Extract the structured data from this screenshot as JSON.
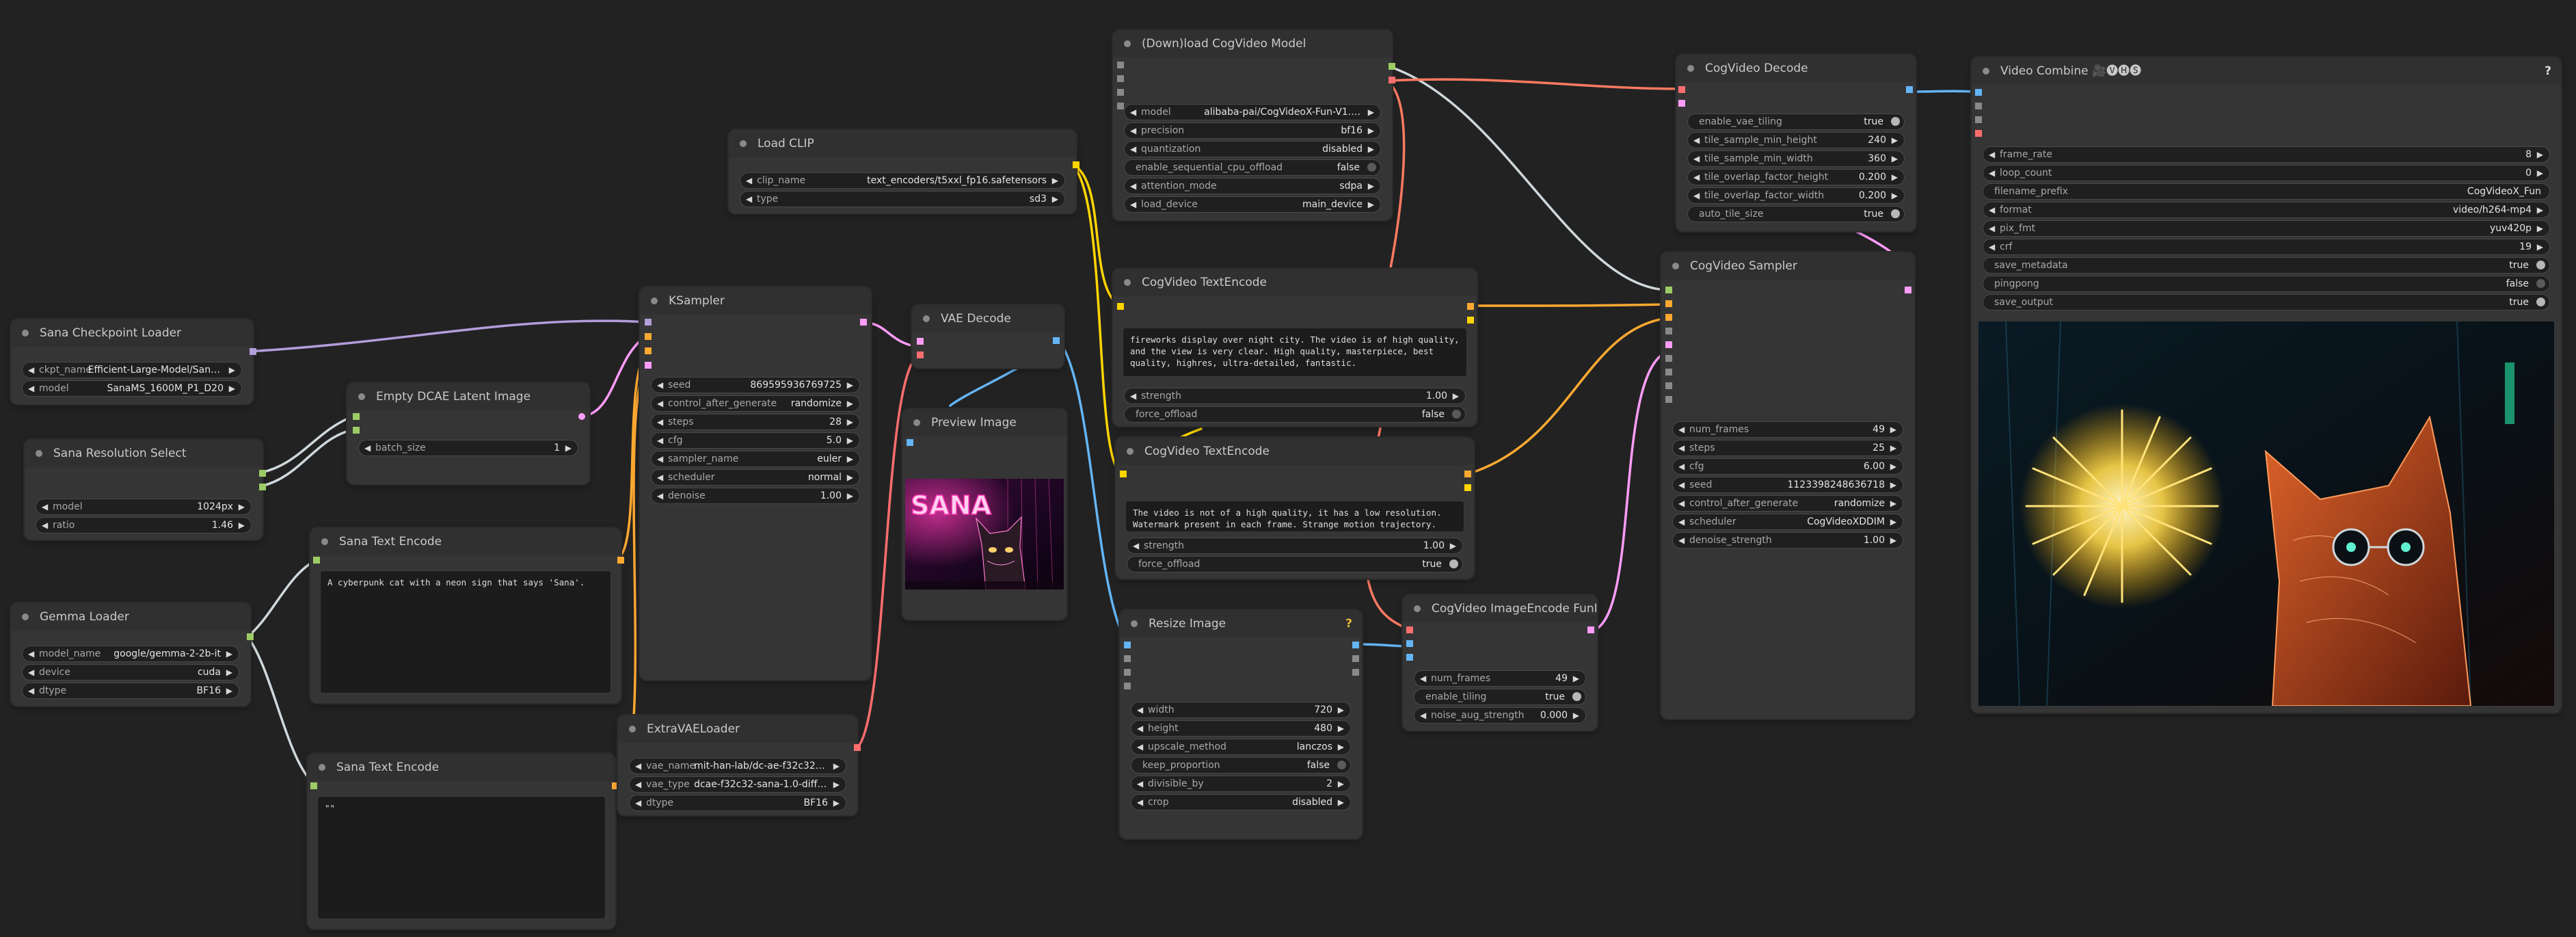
{
  "nodes": {
    "sana_ckpt": {
      "title": "Sana Checkpoint Loader",
      "ckpt_name": {
        "label": "ckpt_name",
        "value": "Efficient-Large-Model/Sana_..."
      },
      "model": {
        "label": "model",
        "value": "SanaMS_1600M_P1_D20"
      }
    },
    "sana_res": {
      "title": "Sana Resolution Select",
      "model": {
        "label": "model",
        "value": "1024px"
      },
      "ratio": {
        "label": "ratio",
        "value": "1.46"
      }
    },
    "gemma": {
      "title": "Gemma Loader",
      "model_name": {
        "label": "model_name",
        "value": "google/gemma-2-2b-it"
      },
      "device": {
        "label": "device",
        "value": "cuda"
      },
      "dtype": {
        "label": "dtype",
        "value": "BF16"
      }
    },
    "dcae": {
      "title": "Empty DCAE Latent Image",
      "batch_size": {
        "label": "batch_size",
        "value": "1"
      }
    },
    "sana_text1": {
      "title": "Sana Text Encode",
      "text": "A cyberpunk cat with a neon sign that says 'Sana'."
    },
    "sana_text2": {
      "title": "Sana Text Encode",
      "text": "\"\""
    },
    "load_clip": {
      "title": "Load CLIP",
      "clip_name": {
        "label": "clip_name",
        "value": "text_encoders/t5xxl_fp16.safetensors"
      },
      "type": {
        "label": "type",
        "value": "sd3"
      }
    },
    "ksampler": {
      "title": "KSampler",
      "seed": {
        "label": "seed",
        "value": "869595936769725"
      },
      "control_after_generate": {
        "label": "control_after_generate",
        "value": "randomize"
      },
      "steps": {
        "label": "steps",
        "value": "28"
      },
      "cfg": {
        "label": "cfg",
        "value": "5.0"
      },
      "sampler_name": {
        "label": "sampler_name",
        "value": "euler"
      },
      "scheduler": {
        "label": "scheduler",
        "value": "normal"
      },
      "denoise": {
        "label": "denoise",
        "value": "1.00"
      }
    },
    "extravae": {
      "title": "ExtraVAELoader",
      "vae_name": {
        "label": "vae_name",
        "value": "mit-han-lab/dc-ae-f32c32-san..."
      },
      "vae_type": {
        "label": "vae_type",
        "value": "dcae-f32c32-sana-1.0-diffusers"
      },
      "dtype": {
        "label": "dtype",
        "value": "BF16"
      }
    },
    "vae_decode": {
      "title": "VAE Decode"
    },
    "preview": {
      "title": "Preview Image",
      "sign_text": "SANA"
    },
    "download_cog": {
      "title": "(Down)load CogVideo Model",
      "model": {
        "label": "model",
        "value": "alibaba-pai/CogVideoX-Fun-V1.1-5b-InP"
      },
      "precision": {
        "label": "precision",
        "value": "bf16"
      },
      "quantization": {
        "label": "quantization",
        "value": "disabled"
      },
      "enable_sequential_cpu_offload": {
        "label": "enable_sequential_cpu_offload",
        "value": "false"
      },
      "attention_mode": {
        "label": "attention_mode",
        "value": "sdpa"
      },
      "load_device": {
        "label": "load_device",
        "value": "main_device"
      }
    },
    "cog_text1": {
      "title": "CogVideo TextEncode",
      "text": "fireworks display over night city. The video is of high quality, and the view is very clear. High quality, masterpiece, best quality, highres, ultra-detailed, fantastic.",
      "strength": {
        "label": "strength",
        "value": "1.00"
      },
      "force_offload": {
        "label": "force_offload",
        "value": "false"
      }
    },
    "cog_text2": {
      "title": "CogVideo TextEncode",
      "text": "The video is not of a high quality, it has a low resolution. Watermark present in each frame. Strange motion trajectory.",
      "strength": {
        "label": "strength",
        "value": "1.00"
      },
      "force_offload": {
        "label": "force_offload",
        "value": "true"
      }
    },
    "resize": {
      "title": "Resize Image",
      "width": {
        "label": "width",
        "value": "720"
      },
      "height": {
        "label": "height",
        "value": "480"
      },
      "upscale_method": {
        "label": "upscale_method",
        "value": "lanczos"
      },
      "keep_proportion": {
        "label": "keep_proportion",
        "value": "false"
      },
      "divisible_by": {
        "label": "divisible_by",
        "value": "2"
      },
      "crop": {
        "label": "crop",
        "value": "disabled"
      }
    },
    "cog_imgenc": {
      "title": "CogVideo ImageEncode FunInP",
      "num_frames": {
        "label": "num_frames",
        "value": "49"
      },
      "enable_tiling": {
        "label": "enable_tiling",
        "value": "true"
      },
      "noise_aug_strength": {
        "label": "noise_aug_strength",
        "value": "0.000"
      }
    },
    "cog_decode": {
      "title": "CogVideo Decode",
      "enable_vae_tiling": {
        "label": "enable_vae_tiling",
        "value": "true"
      },
      "tile_sample_min_height": {
        "label": "tile_sample_min_height",
        "value": "240"
      },
      "tile_sample_min_width": {
        "label": "tile_sample_min_width",
        "value": "360"
      },
      "tile_overlap_factor_height": {
        "label": "tile_overlap_factor_height",
        "value": "0.200"
      },
      "tile_overlap_factor_width": {
        "label": "tile_overlap_factor_width",
        "value": "0.200"
      },
      "auto_tile_size": {
        "label": "auto_tile_size",
        "value": "true"
      }
    },
    "cog_sampler": {
      "title": "CogVideo Sampler",
      "num_frames": {
        "label": "num_frames",
        "value": "49"
      },
      "steps": {
        "label": "steps",
        "value": "25"
      },
      "cfg": {
        "label": "cfg",
        "value": "6.00"
      },
      "seed": {
        "label": "seed",
        "value": "1123398248636718"
      },
      "control_after_generate": {
        "label": "control_after_generate",
        "value": "randomize"
      },
      "scheduler": {
        "label": "scheduler",
        "value": "CogVideoXDDIM"
      },
      "denoise_strength": {
        "label": "denoise_strength",
        "value": "1.00"
      }
    },
    "video_combine": {
      "title": "Video Combine 🎥🅥🅗🅢",
      "frame_rate": {
        "label": "frame_rate",
        "value": "8"
      },
      "loop_count": {
        "label": "loop_count",
        "value": "0"
      },
      "filename_prefix": {
        "label": "filename_prefix",
        "value": "CogVideoX_Fun"
      },
      "format": {
        "label": "format",
        "value": "video/h264-mp4"
      },
      "pix_fmt": {
        "label": "pix_fmt",
        "value": "yuv420p"
      },
      "crf": {
        "label": "crf",
        "value": "19"
      },
      "save_metadata": {
        "label": "save_metadata",
        "value": "true"
      },
      "pingpong": {
        "label": "pingpong",
        "value": "false"
      },
      "save_output": {
        "label": "save_output",
        "value": "true"
      }
    }
  },
  "help_glyph": "?",
  "arrows": {
    "left": "◀",
    "right": "▶"
  },
  "colors": {
    "canvas": "#222222",
    "node": "#353535",
    "title": "#303030",
    "model": "#b39ddb",
    "latent": "#ff9cf9",
    "conditioning": "#ffa931",
    "clip": "#ffd500",
    "vae": "#ff6e6e",
    "image": "#64b5f6",
    "int": "#9ccc65",
    "cogmodel": "#a0a0a0"
  }
}
